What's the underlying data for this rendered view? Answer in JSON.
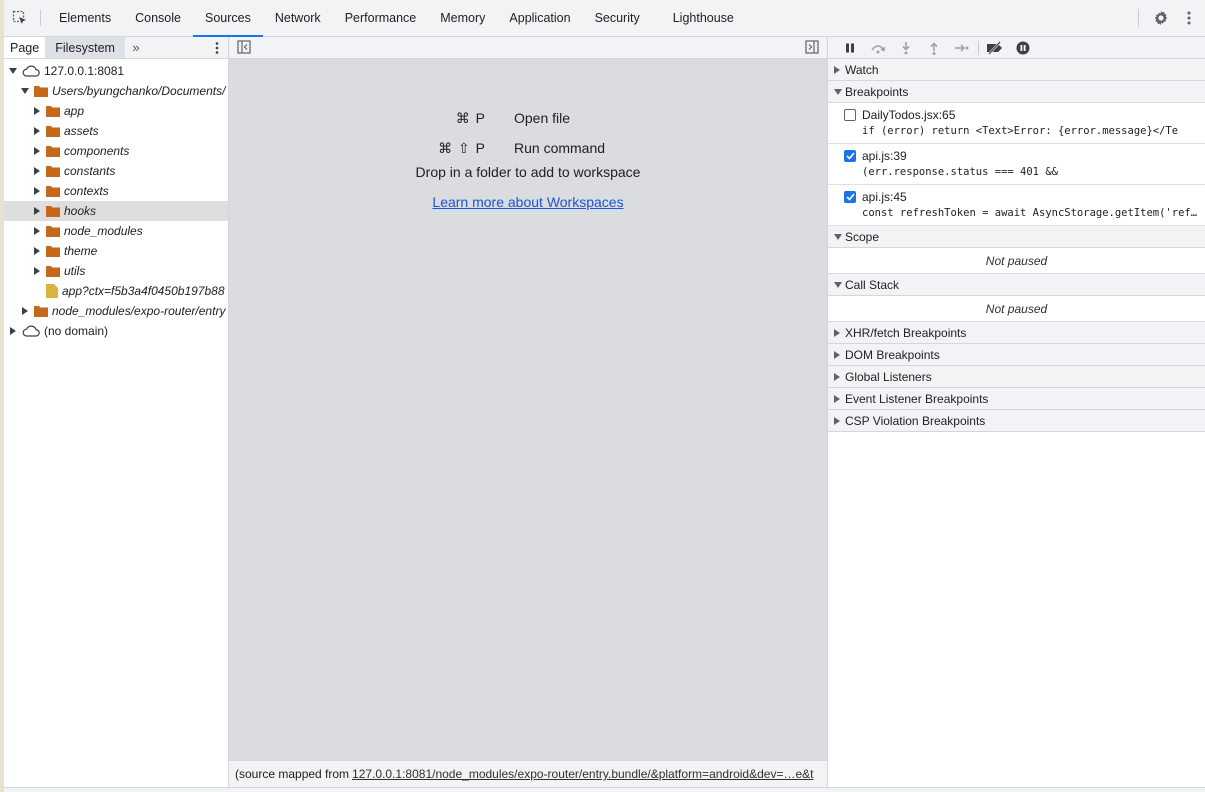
{
  "toolbar": {
    "tabs": [
      {
        "label": "Elements"
      },
      {
        "label": "Console"
      },
      {
        "label": "Sources",
        "active": true
      },
      {
        "label": "Network"
      },
      {
        "label": "Performance"
      },
      {
        "label": "Memory"
      },
      {
        "label": "Application"
      },
      {
        "label": "Security"
      },
      {
        "label": "Lighthouse"
      }
    ],
    "accent_color": "#1a73e8"
  },
  "navigator": {
    "tabs": {
      "page": "Page",
      "filesystem": "Filesystem"
    },
    "tree": [
      {
        "label": "127.0.0.1:8081",
        "type": "cloud",
        "expanded": true
      },
      {
        "label": "Users/byungchanko/Documents/",
        "type": "folder",
        "expanded": true,
        "italic": true
      },
      {
        "label": "app",
        "type": "folder",
        "italic": true
      },
      {
        "label": "assets",
        "type": "folder",
        "italic": true
      },
      {
        "label": "components",
        "type": "folder",
        "italic": true
      },
      {
        "label": "constants",
        "type": "folder",
        "italic": true
      },
      {
        "label": "contexts",
        "type": "folder",
        "italic": true
      },
      {
        "label": "hooks",
        "type": "folder",
        "italic": true,
        "selected": true
      },
      {
        "label": "node_modules",
        "type": "folder",
        "italic": true
      },
      {
        "label": "theme",
        "type": "folder",
        "italic": true
      },
      {
        "label": "utils",
        "type": "folder",
        "italic": true
      },
      {
        "label": "app?ctx=f5b3a4f0450b197b88",
        "type": "file",
        "italic": true
      },
      {
        "label": "node_modules/expo-router/entry",
        "type": "folder",
        "italic": true
      },
      {
        "label": "(no domain)",
        "type": "cloud",
        "italic": false
      }
    ]
  },
  "editor": {
    "shortcuts": [
      {
        "keys": "⌘ P",
        "label": "Open file"
      },
      {
        "keys": "⌘ ⇧ P",
        "label": "Run command"
      }
    ],
    "drop_text": "Drop in a folder to add to workspace",
    "learn_more": "Learn more about Workspaces",
    "status_prefix": "(source mapped from",
    "status_link": "127.0.0.1:8081/node_modules/expo-router/entry.bundle/&platform=android&dev=…e&t"
  },
  "debugger": {
    "watch": "Watch",
    "breakpoints_title": "Breakpoints",
    "breakpoints": [
      {
        "location": "DailyTodos.jsx:65",
        "code": "if (error) return <Text>Error: {error.message}</Te",
        "checked": false
      },
      {
        "location": "api.js:39",
        "code": "(err.response.status === 401 &&",
        "checked": true
      },
      {
        "location": "api.js:45",
        "code": "const refreshToken = await AsyncStorage.getItem('refreshToken');",
        "checked": true
      }
    ],
    "scope_title": "Scope",
    "scope_status": "Not paused",
    "callstack_title": "Call Stack",
    "callstack_status": "Not paused",
    "collapsed_panes": [
      "XHR/fetch Breakpoints",
      "DOM Breakpoints",
      "Global Listeners",
      "Event Listener Breakpoints",
      "CSP Violation Breakpoints"
    ]
  }
}
